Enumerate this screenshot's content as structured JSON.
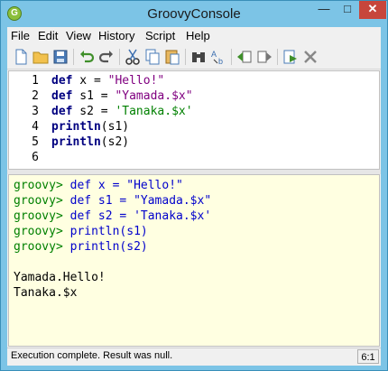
{
  "window": {
    "title": "GroovyConsole",
    "icon_letter": "G",
    "min_label": "—",
    "max_label": "□",
    "close_label": "✕"
  },
  "menu": {
    "items": [
      "File",
      "Edit",
      "View",
      "History",
      "Script",
      "Help"
    ]
  },
  "toolbar": {
    "buttons": [
      "new-file-icon",
      "open-folder-icon",
      "save-icon",
      "undo-icon",
      "redo-icon",
      "cut-icon",
      "copy-icon",
      "paste-icon",
      "find-icon",
      "replace-icon",
      "history-previous-icon",
      "history-next-icon",
      "run-script-icon",
      "interrupt-icon"
    ]
  },
  "editor": {
    "line_numbers": [
      "1",
      "2",
      "3",
      "4",
      "5",
      "6"
    ],
    "lines": [
      {
        "kw": "def",
        "rest": " x = ",
        "str": "\"Hello!\""
      },
      {
        "kw": "def",
        "rest": " s1 = ",
        "str": "\"Yamada.$x\""
      },
      {
        "kw": "def",
        "rest": " s2 = ",
        "str": "'Tanaka.$x'"
      },
      {
        "kw": "println",
        "rest": "(s1)",
        "str": ""
      },
      {
        "kw": "println",
        "rest": "(s2)",
        "str": ""
      }
    ]
  },
  "output": {
    "prompt": "groovy>",
    "echo_lines": [
      "def x = \"Hello!\"",
      "def s1 = \"Yamada.$x\"",
      "def s2 = 'Tanaka.$x'",
      "println(s1)",
      "println(s2)"
    ],
    "result_lines": [
      "Yamada.Hello!",
      "Tanaka.$x"
    ]
  },
  "status": {
    "message": "Execution complete. Result was null.",
    "caret": "6:1"
  },
  "colors": {
    "titlebar": "#7cc4e6",
    "output_bg": "#ffffe1",
    "prompt": "#008000",
    "echo": "#0000cc"
  }
}
